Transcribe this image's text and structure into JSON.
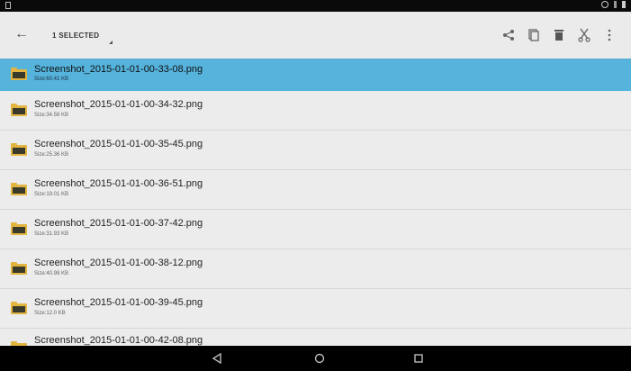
{
  "toolbar": {
    "selected_label": "1 SELECTED",
    "actions": [
      "share-icon",
      "copy-icon",
      "delete-icon",
      "cut-icon",
      "more-vert-icon"
    ]
  },
  "files": [
    {
      "name": "Screenshot_2015-01-01-00-33-08.png",
      "size": "Size:60.41 KB",
      "selected": true
    },
    {
      "name": "Screenshot_2015-01-01-00-34-32.png",
      "size": "Size:34.58 KB",
      "selected": false
    },
    {
      "name": "Screenshot_2015-01-01-00-35-45.png",
      "size": "Size:25.36 KB",
      "selected": false
    },
    {
      "name": "Screenshot_2015-01-01-00-36-51.png",
      "size": "Size:19.01 KB",
      "selected": false
    },
    {
      "name": "Screenshot_2015-01-01-00-37-42.png",
      "size": "Size:31.93 KB",
      "selected": false
    },
    {
      "name": "Screenshot_2015-01-01-00-38-12.png",
      "size": "Size:40.98 KB",
      "selected": false
    },
    {
      "name": "Screenshot_2015-01-01-00-39-45.png",
      "size": "Size:12.0 KB",
      "selected": false
    },
    {
      "name": "Screenshot_2015-01-01-00-42-08.png",
      "size": "",
      "selected": false
    }
  ],
  "colors": {
    "selected_row": "#55b3dc",
    "accent": "#5aaed6",
    "folder": "#e2b440"
  }
}
